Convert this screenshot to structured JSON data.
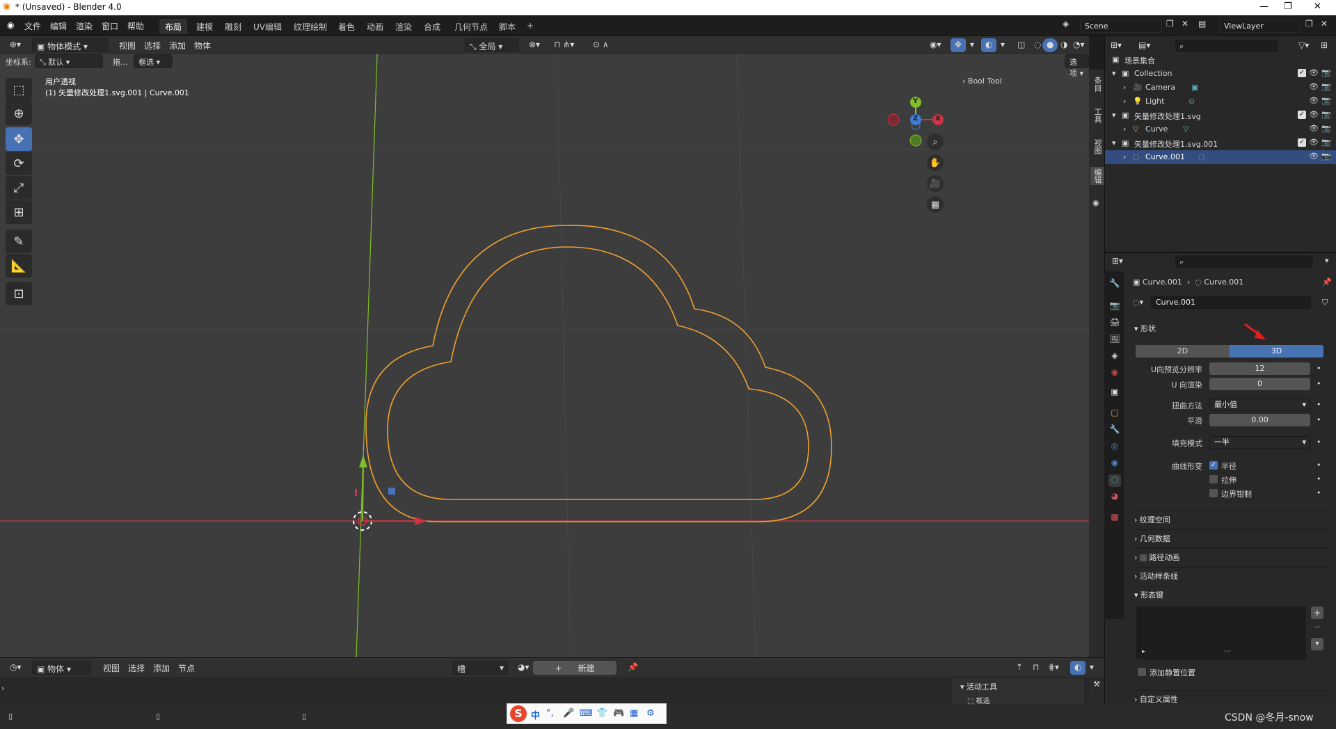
{
  "window": {
    "title": "* (Unsaved) - Blender 4.0"
  },
  "menubar": {
    "menus": [
      "文件",
      "编辑",
      "渲染",
      "窗口",
      "帮助"
    ],
    "workspaces": [
      "布局",
      "建模",
      "雕刻",
      "UV编辑",
      "纹理绘制",
      "着色",
      "动画",
      "渲染",
      "合成",
      "几何节点",
      "脚本"
    ],
    "active_workspace": "布局",
    "add_tab": "+",
    "scene": "Scene",
    "view_layer": "ViewLayer"
  },
  "viewport_header": {
    "mode": "物体模式",
    "menus": [
      "视图",
      "选择",
      "添加",
      "物体"
    ],
    "transform_orientation": "全局",
    "options_label": "选项"
  },
  "viewport_header2": {
    "coord_label": "坐标系:",
    "coord_value": "默认",
    "drag_label": "拖...",
    "select_mode": "框选"
  },
  "viewport": {
    "view_name": "用户透视",
    "object_info": "(1) 矢量修改处理1.svg.001 | Curve.001",
    "sidebar_panel": "Bool Tool",
    "gizmo": {
      "x": "X",
      "y": "Y",
      "z": "Z"
    },
    "side_tabs": [
      "条目",
      "工具",
      "视图",
      "编辑"
    ]
  },
  "outliner": {
    "root": "场景集合",
    "rows": [
      {
        "label": "Collection",
        "indent": 1,
        "checked": true
      },
      {
        "label": "Camera",
        "indent": 2
      },
      {
        "label": "Light",
        "indent": 2
      },
      {
        "label": "矢量修改处理1.svg",
        "indent": 1,
        "checked": true
      },
      {
        "label": "Curve",
        "indent": 2
      },
      {
        "label": "矢量修改处理1.svg.001",
        "indent": 1,
        "checked": true
      },
      {
        "label": "Curve.001",
        "indent": 2,
        "selected": true
      }
    ]
  },
  "properties": {
    "breadcrumb_object": "Curve.001",
    "breadcrumb_data": "Curve.001",
    "datablock_name": "Curve.001",
    "shape_panel": "形状",
    "dim_2d": "2D",
    "dim_3d": "3D",
    "active_dim": "3D",
    "u_preview_label": "U向预览分辨率",
    "u_preview_value": "12",
    "u_render_label": "U 向渲染",
    "u_render_value": "0",
    "twist_label": "扭曲方法",
    "twist_value": "最小值",
    "smooth_label": "平滑",
    "smooth_value": "0.00",
    "fill_label": "填充模式",
    "fill_value": "一半",
    "curve_deform_label": "曲线形变",
    "radius_label": "半径",
    "radius_checked": true,
    "stretch_label": "拉伸",
    "bounds_label": "边界钳制",
    "collapsed_panels": [
      "纹理空间",
      "几何数据",
      "路径动画",
      "活动样条线"
    ],
    "shape_keys_panel": "形态键",
    "add_rest_label": "添加静置位置",
    "custom_props_panel": "自定义属性"
  },
  "timeline": {
    "editor_mode": "物体",
    "menus": [
      "视图",
      "选择",
      "添加",
      "节点"
    ],
    "slot": "槽",
    "new_label": "新建",
    "active_tool_panel": "活动工具",
    "active_tool_value": "框选"
  },
  "status": {
    "watermark": "CSDN @冬月-snow",
    "ime_label": "中"
  },
  "colors": {
    "accent": "#4772b3",
    "curve": "#f0a030",
    "x_axis": "#cc3344",
    "y_axis": "#7fbf2a",
    "selected_row": "#334d80"
  }
}
